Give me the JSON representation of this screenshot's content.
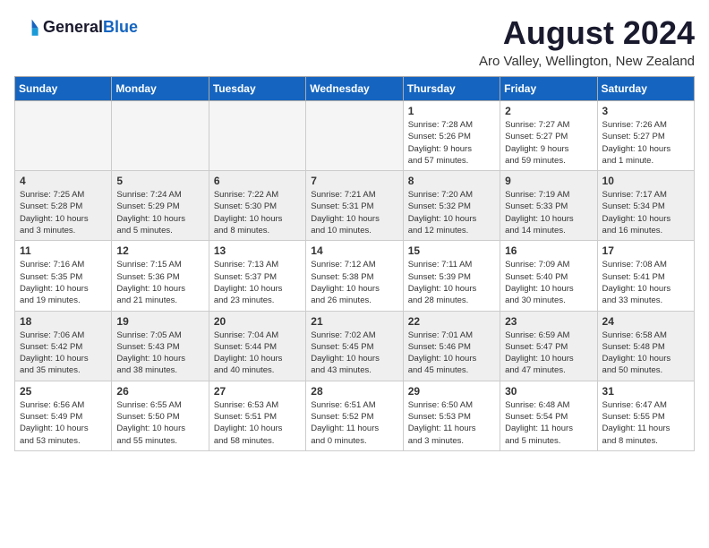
{
  "header": {
    "logo_general": "General",
    "logo_blue": "Blue",
    "title": "August 2024",
    "subtitle": "Aro Valley, Wellington, New Zealand"
  },
  "columns": [
    "Sunday",
    "Monday",
    "Tuesday",
    "Wednesday",
    "Thursday",
    "Friday",
    "Saturday"
  ],
  "weeks": [
    [
      {
        "day": "",
        "info": ""
      },
      {
        "day": "",
        "info": ""
      },
      {
        "day": "",
        "info": ""
      },
      {
        "day": "",
        "info": ""
      },
      {
        "day": "1",
        "info": "Sunrise: 7:28 AM\nSunset: 5:26 PM\nDaylight: 9 hours\nand 57 minutes."
      },
      {
        "day": "2",
        "info": "Sunrise: 7:27 AM\nSunset: 5:27 PM\nDaylight: 9 hours\nand 59 minutes."
      },
      {
        "day": "3",
        "info": "Sunrise: 7:26 AM\nSunset: 5:27 PM\nDaylight: 10 hours\nand 1 minute."
      }
    ],
    [
      {
        "day": "4",
        "info": "Sunrise: 7:25 AM\nSunset: 5:28 PM\nDaylight: 10 hours\nand 3 minutes."
      },
      {
        "day": "5",
        "info": "Sunrise: 7:24 AM\nSunset: 5:29 PM\nDaylight: 10 hours\nand 5 minutes."
      },
      {
        "day": "6",
        "info": "Sunrise: 7:22 AM\nSunset: 5:30 PM\nDaylight: 10 hours\nand 8 minutes."
      },
      {
        "day": "7",
        "info": "Sunrise: 7:21 AM\nSunset: 5:31 PM\nDaylight: 10 hours\nand 10 minutes."
      },
      {
        "day": "8",
        "info": "Sunrise: 7:20 AM\nSunset: 5:32 PM\nDaylight: 10 hours\nand 12 minutes."
      },
      {
        "day": "9",
        "info": "Sunrise: 7:19 AM\nSunset: 5:33 PM\nDaylight: 10 hours\nand 14 minutes."
      },
      {
        "day": "10",
        "info": "Sunrise: 7:17 AM\nSunset: 5:34 PM\nDaylight: 10 hours\nand 16 minutes."
      }
    ],
    [
      {
        "day": "11",
        "info": "Sunrise: 7:16 AM\nSunset: 5:35 PM\nDaylight: 10 hours\nand 19 minutes."
      },
      {
        "day": "12",
        "info": "Sunrise: 7:15 AM\nSunset: 5:36 PM\nDaylight: 10 hours\nand 21 minutes."
      },
      {
        "day": "13",
        "info": "Sunrise: 7:13 AM\nSunset: 5:37 PM\nDaylight: 10 hours\nand 23 minutes."
      },
      {
        "day": "14",
        "info": "Sunrise: 7:12 AM\nSunset: 5:38 PM\nDaylight: 10 hours\nand 26 minutes."
      },
      {
        "day": "15",
        "info": "Sunrise: 7:11 AM\nSunset: 5:39 PM\nDaylight: 10 hours\nand 28 minutes."
      },
      {
        "day": "16",
        "info": "Sunrise: 7:09 AM\nSunset: 5:40 PM\nDaylight: 10 hours\nand 30 minutes."
      },
      {
        "day": "17",
        "info": "Sunrise: 7:08 AM\nSunset: 5:41 PM\nDaylight: 10 hours\nand 33 minutes."
      }
    ],
    [
      {
        "day": "18",
        "info": "Sunrise: 7:06 AM\nSunset: 5:42 PM\nDaylight: 10 hours\nand 35 minutes."
      },
      {
        "day": "19",
        "info": "Sunrise: 7:05 AM\nSunset: 5:43 PM\nDaylight: 10 hours\nand 38 minutes."
      },
      {
        "day": "20",
        "info": "Sunrise: 7:04 AM\nSunset: 5:44 PM\nDaylight: 10 hours\nand 40 minutes."
      },
      {
        "day": "21",
        "info": "Sunrise: 7:02 AM\nSunset: 5:45 PM\nDaylight: 10 hours\nand 43 minutes."
      },
      {
        "day": "22",
        "info": "Sunrise: 7:01 AM\nSunset: 5:46 PM\nDaylight: 10 hours\nand 45 minutes."
      },
      {
        "day": "23",
        "info": "Sunrise: 6:59 AM\nSunset: 5:47 PM\nDaylight: 10 hours\nand 47 minutes."
      },
      {
        "day": "24",
        "info": "Sunrise: 6:58 AM\nSunset: 5:48 PM\nDaylight: 10 hours\nand 50 minutes."
      }
    ],
    [
      {
        "day": "25",
        "info": "Sunrise: 6:56 AM\nSunset: 5:49 PM\nDaylight: 10 hours\nand 53 minutes."
      },
      {
        "day": "26",
        "info": "Sunrise: 6:55 AM\nSunset: 5:50 PM\nDaylight: 10 hours\nand 55 minutes."
      },
      {
        "day": "27",
        "info": "Sunrise: 6:53 AM\nSunset: 5:51 PM\nDaylight: 10 hours\nand 58 minutes."
      },
      {
        "day": "28",
        "info": "Sunrise: 6:51 AM\nSunset: 5:52 PM\nDaylight: 11 hours\nand 0 minutes."
      },
      {
        "day": "29",
        "info": "Sunrise: 6:50 AM\nSunset: 5:53 PM\nDaylight: 11 hours\nand 3 minutes."
      },
      {
        "day": "30",
        "info": "Sunrise: 6:48 AM\nSunset: 5:54 PM\nDaylight: 11 hours\nand 5 minutes."
      },
      {
        "day": "31",
        "info": "Sunrise: 6:47 AM\nSunset: 5:55 PM\nDaylight: 11 hours\nand 8 minutes."
      }
    ]
  ]
}
